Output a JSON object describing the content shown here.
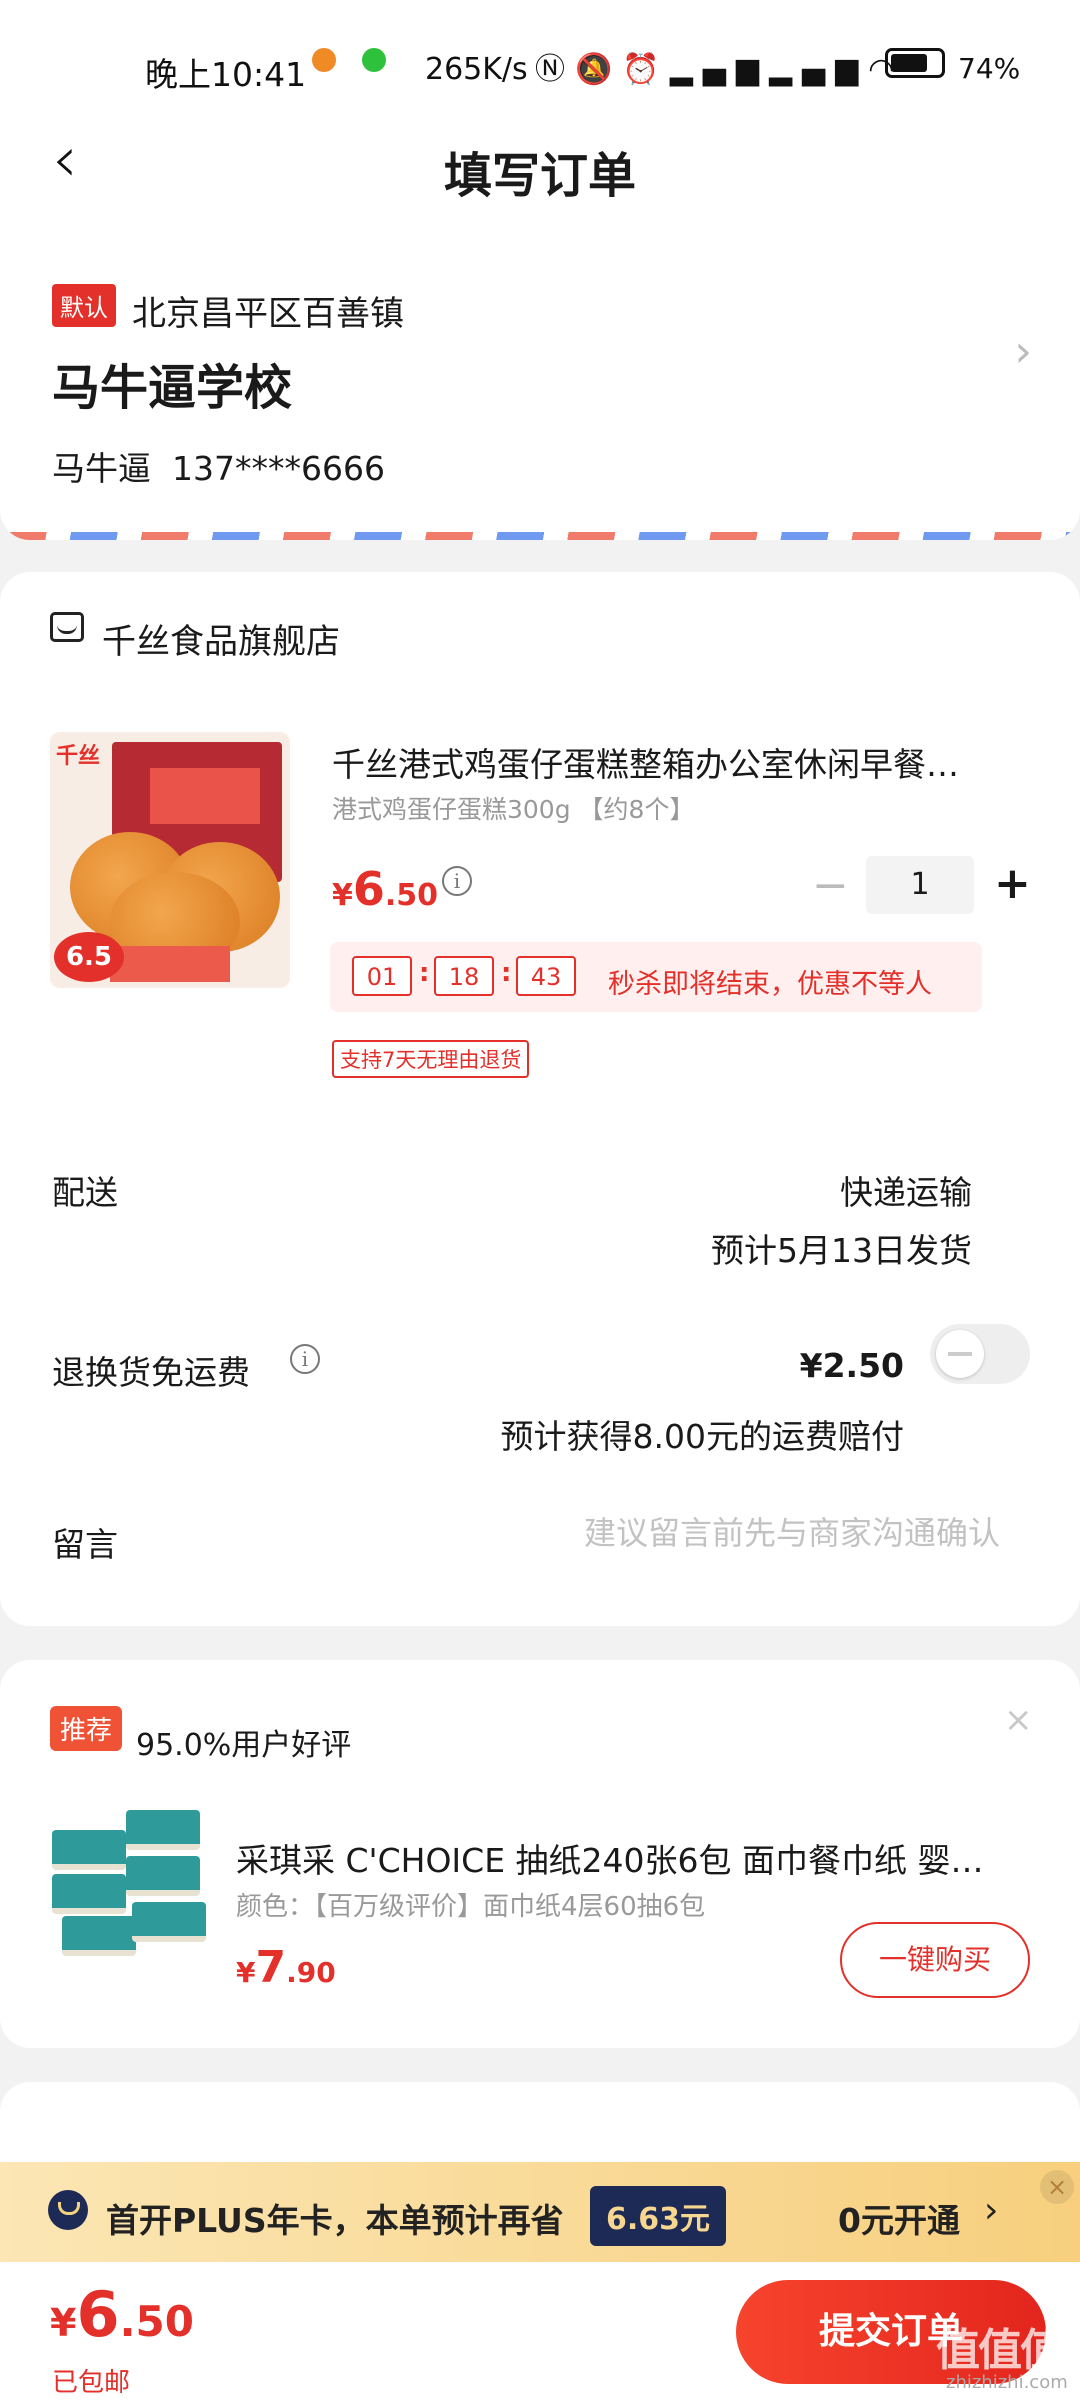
{
  "status_bar": {
    "time": "晚上10:41",
    "net_speed": "265K/s",
    "battery_pct": "74%",
    "battery_level": 0.74
  },
  "nav": {
    "title": "填写订单"
  },
  "address": {
    "default_badge": "默认",
    "region": "北京昌平区百善镇",
    "name": "马牛逼学校",
    "contact_name": "马牛逼",
    "phone": "137****6666"
  },
  "shop": {
    "name": "千丝食品旗舰店",
    "product": {
      "image_brand": "千丝",
      "image_price": "6.5",
      "title": "千丝港式鸡蛋仔蛋糕整箱办公室休闲早餐…",
      "spec": "港式鸡蛋仔蛋糕300g 【约8个】",
      "price_symbol": "¥",
      "price_int": "6",
      "price_dec": ".50",
      "minus": "−",
      "quantity": "1",
      "plus": "+",
      "countdown": {
        "hh": "01",
        "mm": "18",
        "ss": "43",
        "text": "秒杀即将结束，优惠不等人"
      },
      "return_tag": "支持7天无理由退货"
    },
    "delivery": {
      "label": "配送",
      "method": "快递运输",
      "eta": "预计5月13日发货"
    },
    "return_insurance": {
      "label": "退换货免运费",
      "price": "¥2.50",
      "note": "预计获得8.00元的运费赔付",
      "enabled": false
    },
    "message": {
      "label": "留言",
      "placeholder": "建议留言前先与商家沟通确认"
    }
  },
  "recommend": {
    "badge": "推荐",
    "rating": "95.0%用户好评",
    "close": "×",
    "title": "采琪采 C'CHOICE 抽纸240张6包 面巾餐巾纸 婴…",
    "spec": "颜色：【百万级评价】面巾纸4层60抽6包",
    "price_symbol": "¥",
    "price_int": "7",
    "price_dec": ".90",
    "buy_label": "一键购买"
  },
  "plus_banner": {
    "text": "首开PLUS年卡，本单预计再省",
    "save_amount": "6.63元",
    "open_label": "0元开通",
    "arrow": "›",
    "close": "×"
  },
  "bottom": {
    "total_symbol": "¥",
    "total_int": "6",
    "total_dec": ".50",
    "shipping": "已包邮",
    "submit_label": "提交订单",
    "watermark": "值值值",
    "watermark_url": "zhizhizhi.com"
  },
  "colors": {
    "accent": "#e3302a",
    "plus_dark": "#1d2a55",
    "plus_gold": "#f7cf7e"
  },
  "icons": [
    "back-arrow-icon",
    "chevron-right-icon",
    "shop-icon",
    "info-icon",
    "toggle-switch",
    "plus-logo-icon",
    "close-icon"
  ]
}
